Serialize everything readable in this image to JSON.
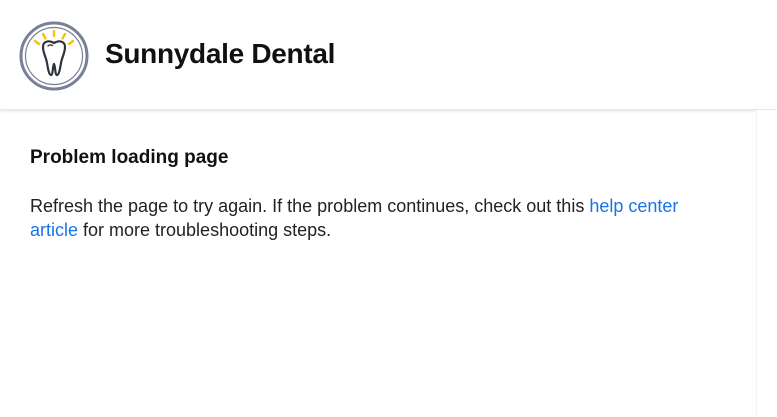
{
  "header": {
    "brand_name": "Sunnydale Dental",
    "logo_icon": "tooth-icon",
    "logo_colors": {
      "ring": "#7a7f98",
      "tooth": "#2f3340",
      "rays": "#f4c20d"
    }
  },
  "error": {
    "title": "Problem loading page",
    "message_before": "Refresh the page to try again. If the problem continues, check out this ",
    "link_text": "help center article",
    "message_after": " for more troubleshooting steps.",
    "link_color": "#1a73e8"
  }
}
